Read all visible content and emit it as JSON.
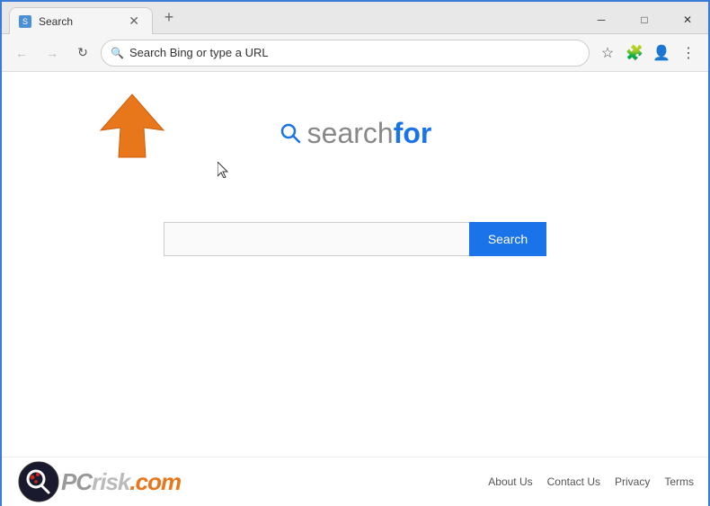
{
  "browser": {
    "tab_title": "Search",
    "tab_favicon": "S",
    "close_symbol": "✕",
    "new_tab_symbol": "+",
    "win_minimize": "─",
    "win_restore": "□",
    "win_close": "✕",
    "address_bar": {
      "placeholder": "Search Bing or type a URL",
      "icon": "🔍"
    },
    "nav": {
      "back": "←",
      "forward": "→",
      "refresh": "↻"
    },
    "toolbar_icons": {
      "star": "☆",
      "extension": "🧩",
      "profile": "👤",
      "menu": "⋮"
    }
  },
  "logo": {
    "search_icon": "🔍",
    "text_regular": "search",
    "text_bold": "for"
  },
  "search": {
    "input_placeholder": "",
    "button_label": "Search"
  },
  "footer": {
    "pc_text": "PC",
    "risk_text": "risk",
    "com_text": ".com",
    "links": [
      {
        "label": "About Us"
      },
      {
        "label": "Contact Us"
      },
      {
        "label": "Privacy"
      },
      {
        "label": "Terms"
      }
    ]
  }
}
